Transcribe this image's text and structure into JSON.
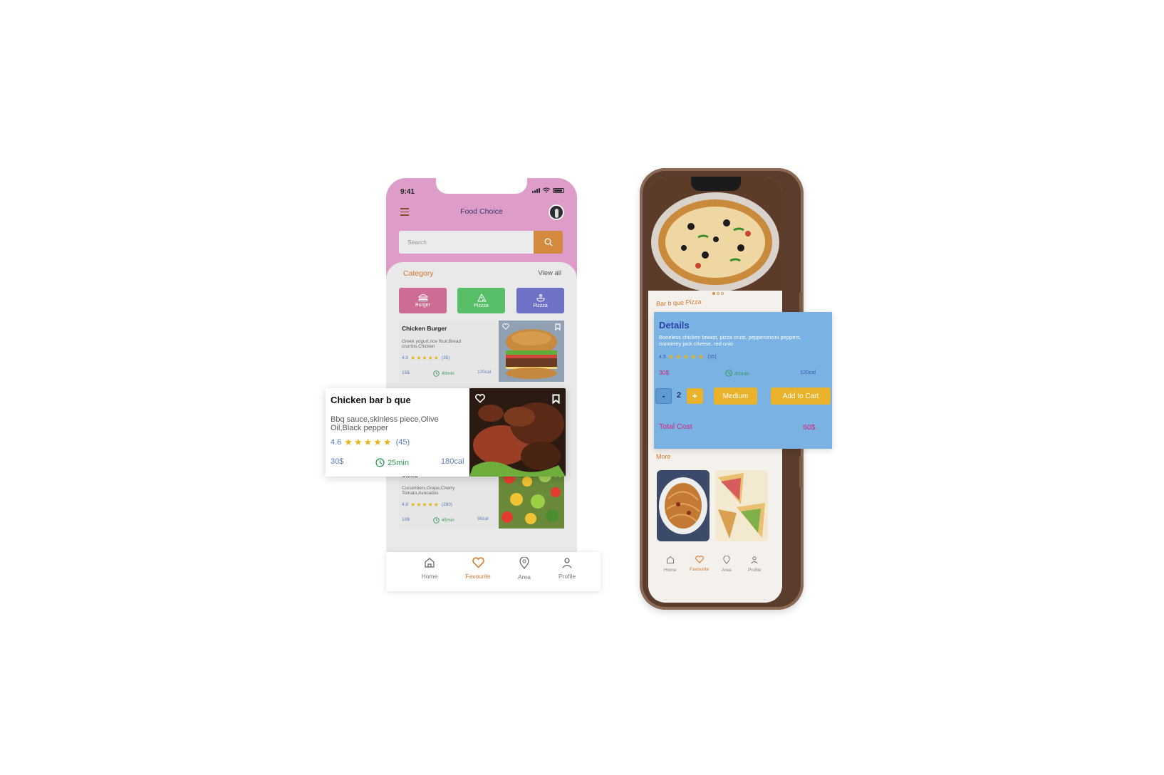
{
  "left_phone": {
    "status_time": "9:41",
    "app_title": "Food Choice",
    "search": {
      "placeholder": "Search"
    },
    "category": {
      "label": "Category",
      "view_all": "View all",
      "chips": [
        {
          "label": "Burger",
          "color": "#cd6c94",
          "icon": "burger-icon"
        },
        {
          "label": "Pizzza",
          "color": "#58be68",
          "icon": "pizza-slice-icon"
        },
        {
          "label": "Pizzza",
          "color": "#6e72c6",
          "icon": "noodles-icon"
        }
      ]
    },
    "food_cards": [
      {
        "name": "Chicken Burger",
        "description": "Greek yogurt,rice flour,Bread crumbs,Chicken",
        "rating": "4.9",
        "stars": "★★★★★",
        "reviews": "(35)",
        "price": "15$",
        "time": "40min",
        "calories": "120cal"
      },
      {
        "name": "Salad",
        "description": "Cucumbers,Grape,Cherry Tomato,Avocados",
        "rating": "4.8",
        "stars": "★★★★★",
        "reviews": "(290)",
        "price": "10$",
        "time": "45min",
        "calories": "90cal"
      }
    ],
    "featured_card": {
      "name": "Chicken bar b que",
      "description": "Bbq sauce,skinless piece,Olive Oil,Black pepper",
      "rating": "4.6",
      "stars": "★★★★★",
      "reviews": "(45)",
      "price": "30$",
      "time": "25min",
      "calories": "180cal"
    },
    "bottom_nav": [
      {
        "label": "Home",
        "icon": "home-icon",
        "active": false
      },
      {
        "label": "Favourite",
        "icon": "heart-icon",
        "active": true
      },
      {
        "label": "Area",
        "icon": "location-pin-icon",
        "active": false
      },
      {
        "label": "Profile",
        "icon": "user-icon",
        "active": false
      }
    ]
  },
  "right_phone": {
    "dish_title": "Bar b que Pizza",
    "carousel": {
      "total": 3,
      "active": 1
    },
    "details": {
      "title": "Details",
      "description": "Boneless chicken breast, pizza crust, pepperoncini peppers, monterey jack cheese, red onio",
      "rating": "4.9",
      "stars": "★★★★★",
      "reviews": "(35)",
      "price": "30$",
      "time": "40min",
      "calories": "120cal",
      "quantity": {
        "minus_label": "-",
        "value": "2",
        "plus_label": "+"
      },
      "size_label": "Medium",
      "add_to_cart_label": "Add to Cart",
      "total_label": "Total Cost",
      "total_value": "60$"
    },
    "more_label": "More",
    "bottom_nav": [
      {
        "label": "Home",
        "icon": "home-icon",
        "active": false
      },
      {
        "label": "Favourite",
        "icon": "heart-icon",
        "active": true
      },
      {
        "label": "Area",
        "icon": "location-pin-icon",
        "active": false
      },
      {
        "label": "Profile",
        "icon": "user-icon",
        "active": false
      }
    ]
  },
  "colors": {
    "header_pink": "#de9cc8",
    "accent_orange": "#d48a3e",
    "details_blue": "#7ab3e3",
    "button_yellow": "#eab22a",
    "total_magenta": "#d8207a",
    "star_yellow": "#e8b21c"
  }
}
